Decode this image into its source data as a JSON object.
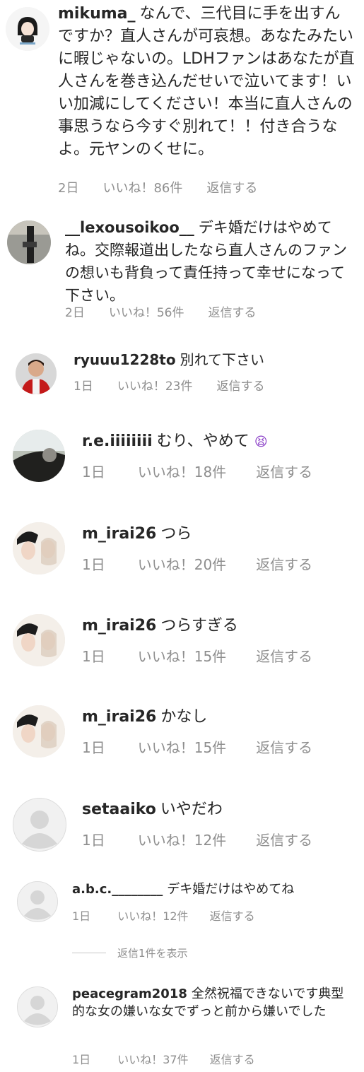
{
  "comments": [
    {
      "username": "mikuma_",
      "text": "なんで、三代目に手を出すんですか？直人さんが可哀想。あなたみたいに暇じゃないの。LDHファンはあなたが直人さんを巻き込んだせいで泣いてます！いい加減にしてください！本当に直人さんの事思うなら今すぐ別れて！！付き合うなよ。元ヤンのくせに。",
      "time": "2日",
      "likes": "いいね！86件",
      "reply": "返信する"
    },
    {
      "username": "__lexousoikoo__",
      "text": "デキ婚だけはやめてね。交際報道出したなら直人さんのファンの想いも背負って責任持って幸せになって下さい。",
      "time": "2日",
      "likes": "いいね！56件",
      "reply": "返信する"
    },
    {
      "username": "ryuuu1228to",
      "text": "別れて下さい",
      "time": "1日",
      "likes": "いいね！23件",
      "reply": "返信する"
    },
    {
      "username": "r.e.iiiiiiii",
      "text": "むり、やめて",
      "emoji": "😫",
      "time": "1日",
      "likes": "いいね！18件",
      "reply": "返信する"
    },
    {
      "username": "m_irai26",
      "text": "つら",
      "time": "1日",
      "likes": "いいね！20件",
      "reply": "返信する"
    },
    {
      "username": "m_irai26",
      "text": "つらすぎる",
      "time": "1日",
      "likes": "いいね！15件",
      "reply": "返信する"
    },
    {
      "username": "m_irai26",
      "text": "かなし",
      "time": "1日",
      "likes": "いいね！15件",
      "reply": "返信する"
    },
    {
      "username": "setaaiko",
      "text": "いやだわ",
      "time": "1日",
      "likes": "いいね！12件",
      "reply": "返信する"
    },
    {
      "username": "a.b.c.________",
      "text": "デキ婚だけはやめてね",
      "time": "1日",
      "likes": "いいね！12件",
      "reply": "返信する"
    },
    {
      "username": "peacegram2018",
      "text": "全然祝福できないです典型的な女の嫌いな女でずっと前から嫌いでした",
      "time": "1日",
      "likes": "いいね！37件",
      "reply": "返信する"
    }
  ],
  "view_replies": "返信1件を表示"
}
